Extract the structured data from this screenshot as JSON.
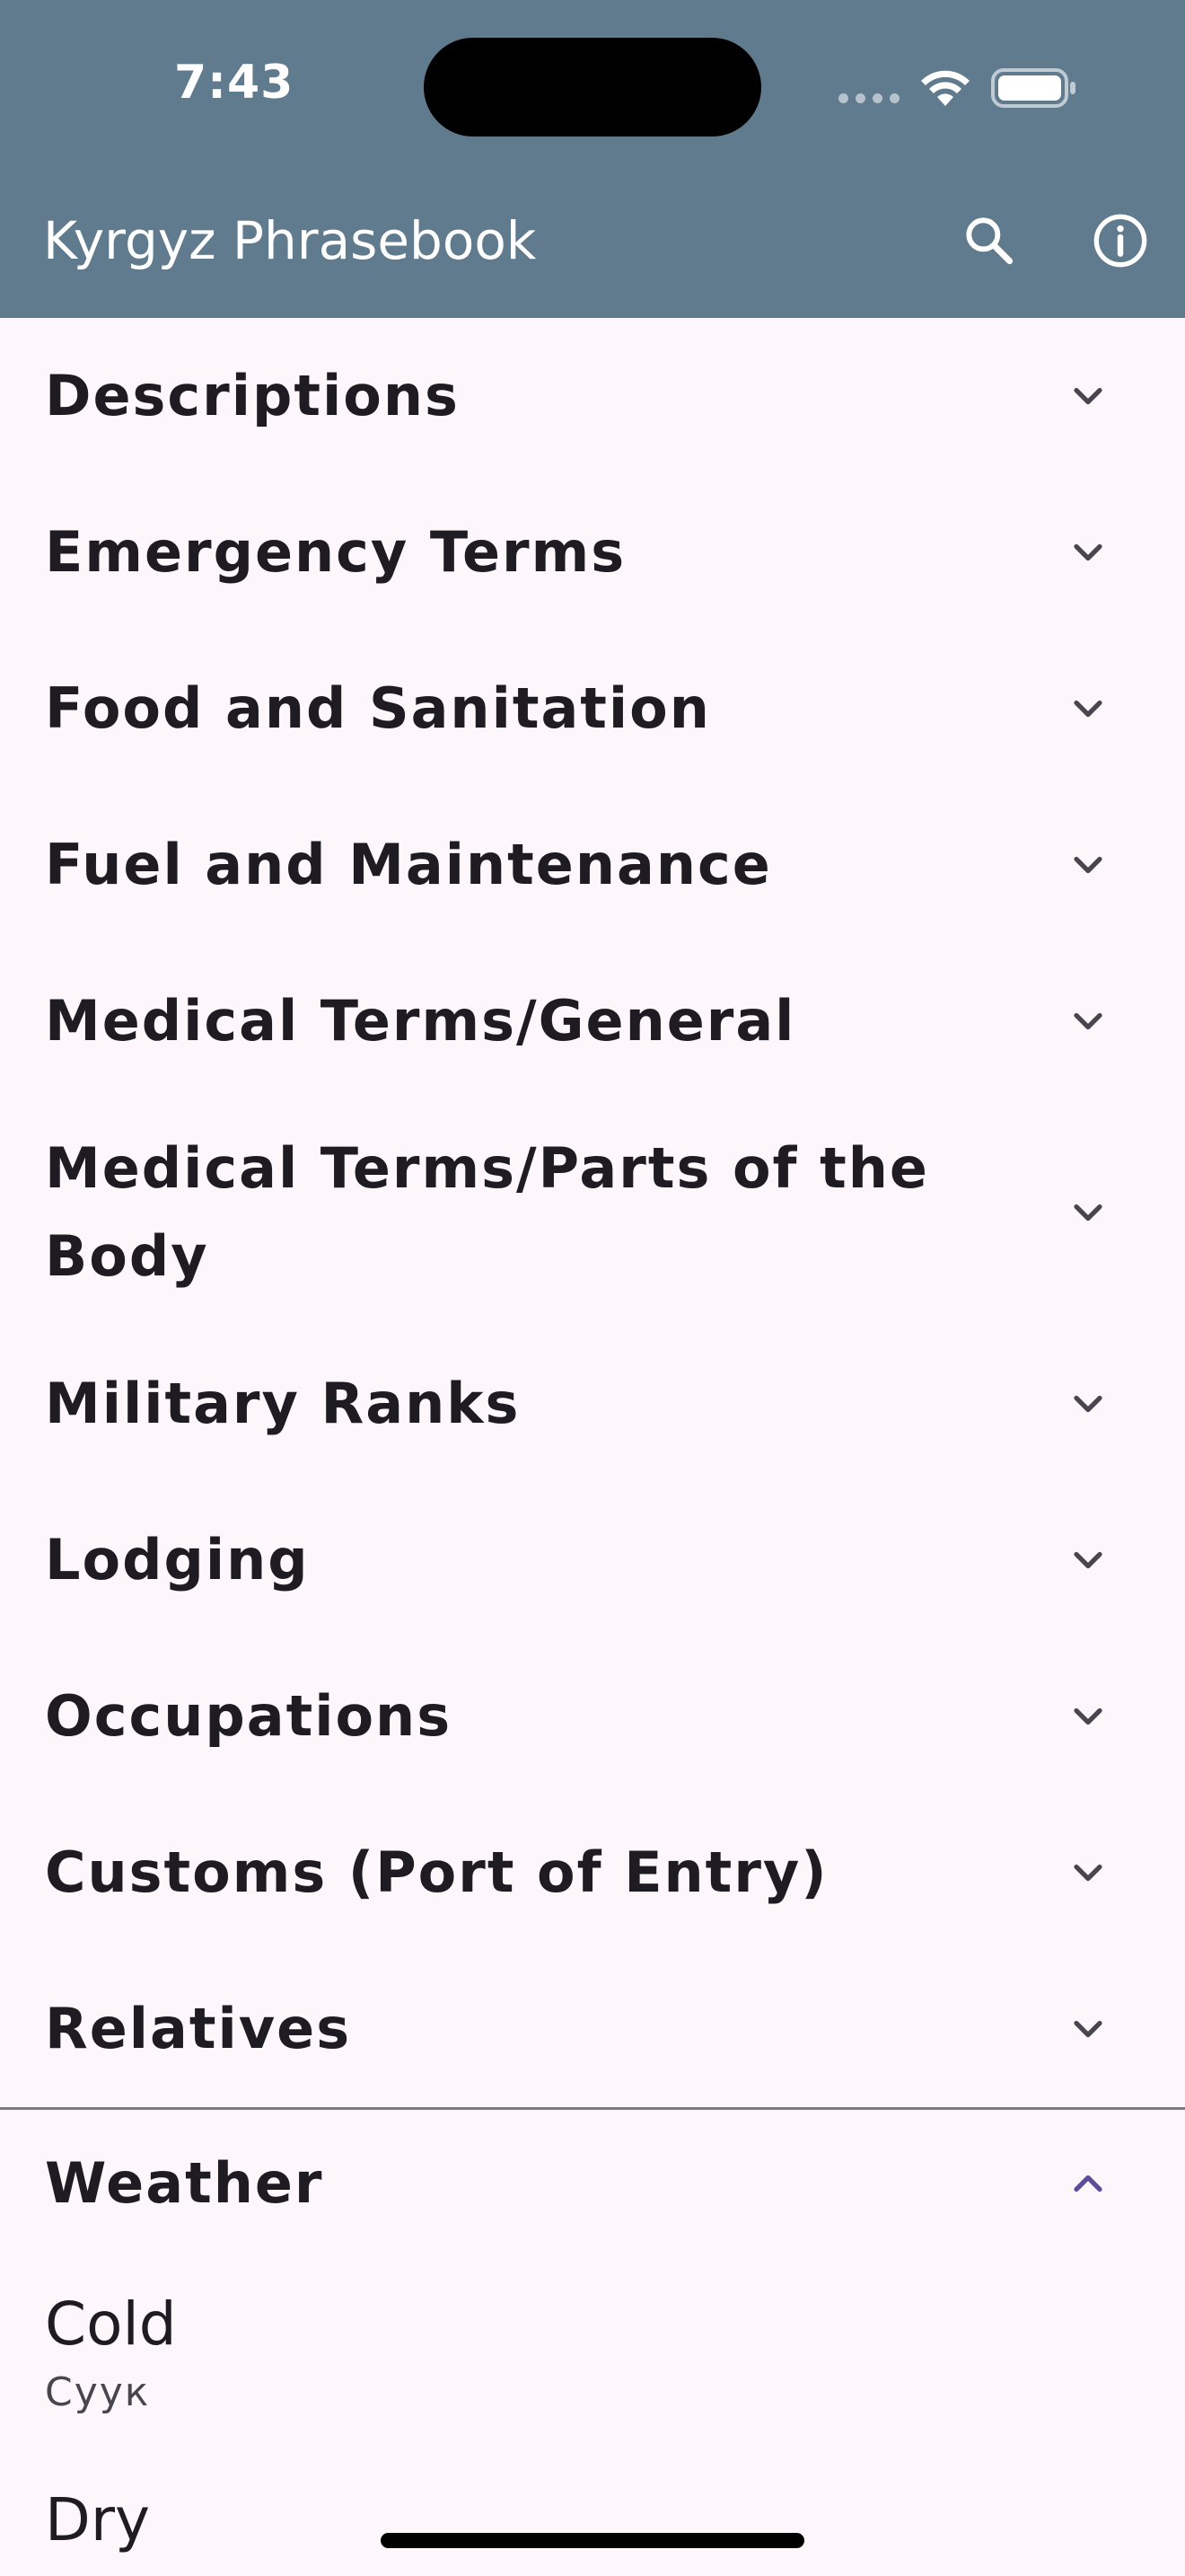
{
  "status_bar": {
    "time": "7:43"
  },
  "app_bar": {
    "title": "Kyrgyz Phrasebook",
    "search_icon": "search-icon",
    "info_icon": "info-icon",
    "background_color": "#607a8e"
  },
  "categories": [
    {
      "label": "Descriptions"
    },
    {
      "label": "Emergency Terms"
    },
    {
      "label": "Food and Sanitation"
    },
    {
      "label": "Fuel and Maintenance"
    },
    {
      "label": "Medical Terms/General"
    },
    {
      "label": "Medical Terms/Parts of the Body"
    },
    {
      "label": "Military Ranks"
    },
    {
      "label": "Lodging"
    },
    {
      "label": "Occupations"
    },
    {
      "label": "Customs (Port of Entry)"
    },
    {
      "label": "Relatives"
    }
  ],
  "expanded_category": {
    "label": "Weather",
    "accent_color": "#5b4d9a",
    "phrases": [
      {
        "english": "Cold",
        "kyrgyz": "Суук"
      },
      {
        "english": "Dry",
        "kyrgyz": ""
      }
    ]
  }
}
